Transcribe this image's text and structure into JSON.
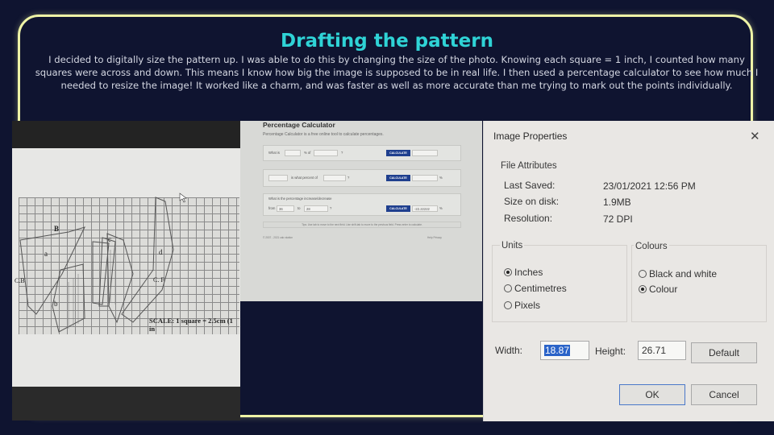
{
  "slide": {
    "title": "Drafting the pattern",
    "body": "I decided to digitally size the pattern up. I was able to do this by changing the size of the photo. Knowing each square = 1 inch, I counted how many squares were across and down. This means I know how big the image is supposed to be in real life. I then used a percentage calculator to see how much I needed to resize the image! It worked like a charm, and was faster as well as more accurate  than me trying to mark out the points individually.",
    "frame_color": "#eef3a6",
    "title_color": "#2fd3d6",
    "background_color": "#0f1430"
  },
  "pattern_photo": {
    "labels": {
      "b": "B",
      "a": "a",
      "c": "c",
      "d": "d",
      "cb": "C.B",
      "b2": "b",
      "cf": "C. F"
    },
    "scale_text": "SCALE: 1 square = 2.5cm (1 in"
  },
  "calculator_photo": {
    "title": "Percentage Calculator",
    "subtitle": "Percentage Calculator is a free online tool to calculate percentages.",
    "row1": {
      "what_is": "What is",
      "pct_of": "% of",
      "q": "?",
      "button": "CALCULATE"
    },
    "row2": {
      "is_what": "is what percent of",
      "q": "?",
      "button": "CALCULATE",
      "pct": "%"
    },
    "row3": {
      "label": "What is the percentage increase/decrease",
      "from": "from",
      "from_value": "36",
      "to": "to",
      "to_value": "28",
      "q": "?",
      "button": "CALCULATE",
      "result": "-22.22222",
      "pct": "%"
    },
    "note": "Tips: Use tab to move to the next field. Use shift-tab to move to the previous field. Press enter to calculate.",
    "footer_left": "© 2007 - 2021 calc station",
    "footer_right": "Help  Privacy"
  },
  "image_properties": {
    "title": "Image Properties",
    "close_icon": "close-icon",
    "file_attributes": {
      "label": "File Attributes",
      "rows": [
        {
          "key": "Last Saved:",
          "value": "23/01/2021 12:56 PM"
        },
        {
          "key": "Size on disk:",
          "value": "1.9MB"
        },
        {
          "key": "Resolution:",
          "value": "72 DPI"
        }
      ]
    },
    "units": {
      "label": "Units",
      "options": [
        {
          "label": "Inches",
          "selected": true
        },
        {
          "label": "Centimetres",
          "selected": false
        },
        {
          "label": "Pixels",
          "selected": false
        }
      ]
    },
    "colours": {
      "label": "Colours",
      "options": [
        {
          "label": "Black and white",
          "selected": false
        },
        {
          "label": "Colour",
          "selected": true
        }
      ]
    },
    "width_label": "Width:",
    "width_value": "18.87",
    "height_label": "Height:",
    "height_value": "26.71",
    "default_button": "Default",
    "ok_button": "OK",
    "cancel_button": "Cancel"
  }
}
